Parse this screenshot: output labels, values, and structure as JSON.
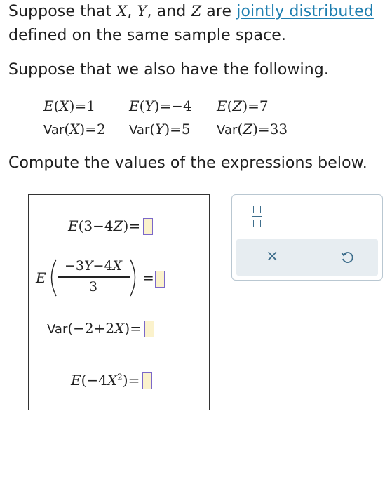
{
  "intro": {
    "line1_a": "Suppose that ",
    "var_x": "X",
    "sep1": ", ",
    "var_y": "Y",
    "sep2": ", and ",
    "var_z": "Z",
    "line1_b": " are ",
    "link_text": "jointly distributed",
    "line2": "defined on the same sample space.",
    "line3": "Suppose that we also have the following.",
    "prompt": "Compute the values of the expressions below."
  },
  "given": {
    "ex": "E(X)=1",
    "ey": "E(Y)=−4",
    "ez": "E(Z)=7",
    "varx": "Var(X)=2",
    "vary": "Var(Y)=5",
    "varz": "Var(Z)=33"
  },
  "expressions": {
    "e1": "E(3−4Z)=",
    "e2_E": "E",
    "e2_num": "−3Y−4X",
    "e2_den": "3",
    "e2_eq": "=",
    "e3_var": "Var",
    "e3_body": "(−2+2X)=",
    "e4": "E(−4X²)="
  },
  "toolbar": {
    "fraction_label": "fraction",
    "clear_label": "×",
    "undo_label": "↺"
  }
}
